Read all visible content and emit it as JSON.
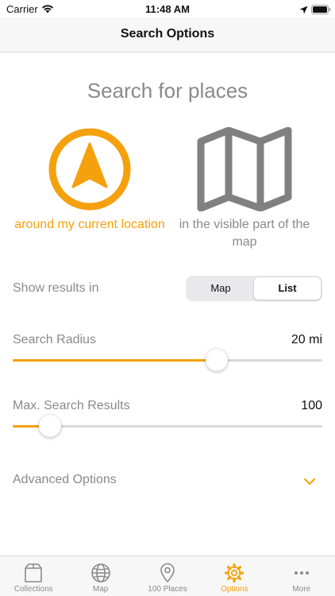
{
  "status_bar": {
    "carrier": "Carrier",
    "time": "11:48 AM"
  },
  "nav": {
    "title": "Search Options"
  },
  "search": {
    "heading": "Search for places",
    "options": [
      {
        "label": "around my current location",
        "selected": true,
        "icon": "navigation-arrow-icon"
      },
      {
        "label": "in the visible part of the map",
        "selected": false,
        "icon": "map-icon"
      }
    ]
  },
  "results": {
    "label": "Show results in",
    "segments": [
      "Map",
      "List"
    ],
    "selected": "List"
  },
  "radius": {
    "label": "Search Radius",
    "value_text": "20 mi",
    "fraction": 0.66
  },
  "max_results": {
    "label": "Max. Search Results",
    "value_text": "100",
    "fraction": 0.12
  },
  "advanced": {
    "label": "Advanced Options"
  },
  "tab_bar": {
    "tabs": [
      {
        "label": "Collections",
        "icon": "collections-box-icon"
      },
      {
        "label": "Map",
        "icon": "globe-icon"
      },
      {
        "label": "100 Places",
        "icon": "location-pin-icon"
      },
      {
        "label": "Options",
        "icon": "gear-icon"
      },
      {
        "label": "More",
        "icon": "ellipsis-icon"
      }
    ],
    "active": "Options"
  },
  "colors": {
    "accent": "#f5a00d",
    "muted": "#8a8a8a",
    "icon_gray": "#808080",
    "track": "#d9d9d9"
  }
}
